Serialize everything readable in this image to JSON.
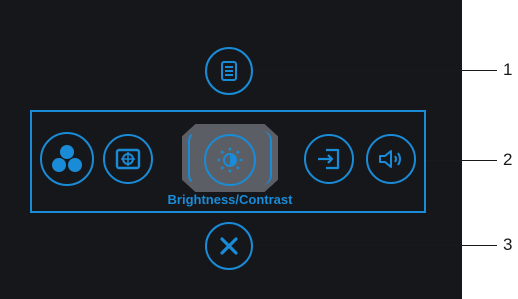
{
  "osd": {
    "menu_button_icon": "menu-list-icon",
    "shortcut_icons": [
      "color-preset-icon",
      "display-mode-icon",
      "brightness-contrast-icon",
      "input-source-icon",
      "volume-icon"
    ],
    "selected_label": "Brightness/Contrast",
    "exit_button_icon": "close-icon"
  },
  "callouts": {
    "one": "1",
    "two": "2",
    "three": "3"
  },
  "colors": {
    "accent": "#1a8bd6",
    "panel_bg": "#16171b",
    "selected_bg": "#5b5f65"
  }
}
